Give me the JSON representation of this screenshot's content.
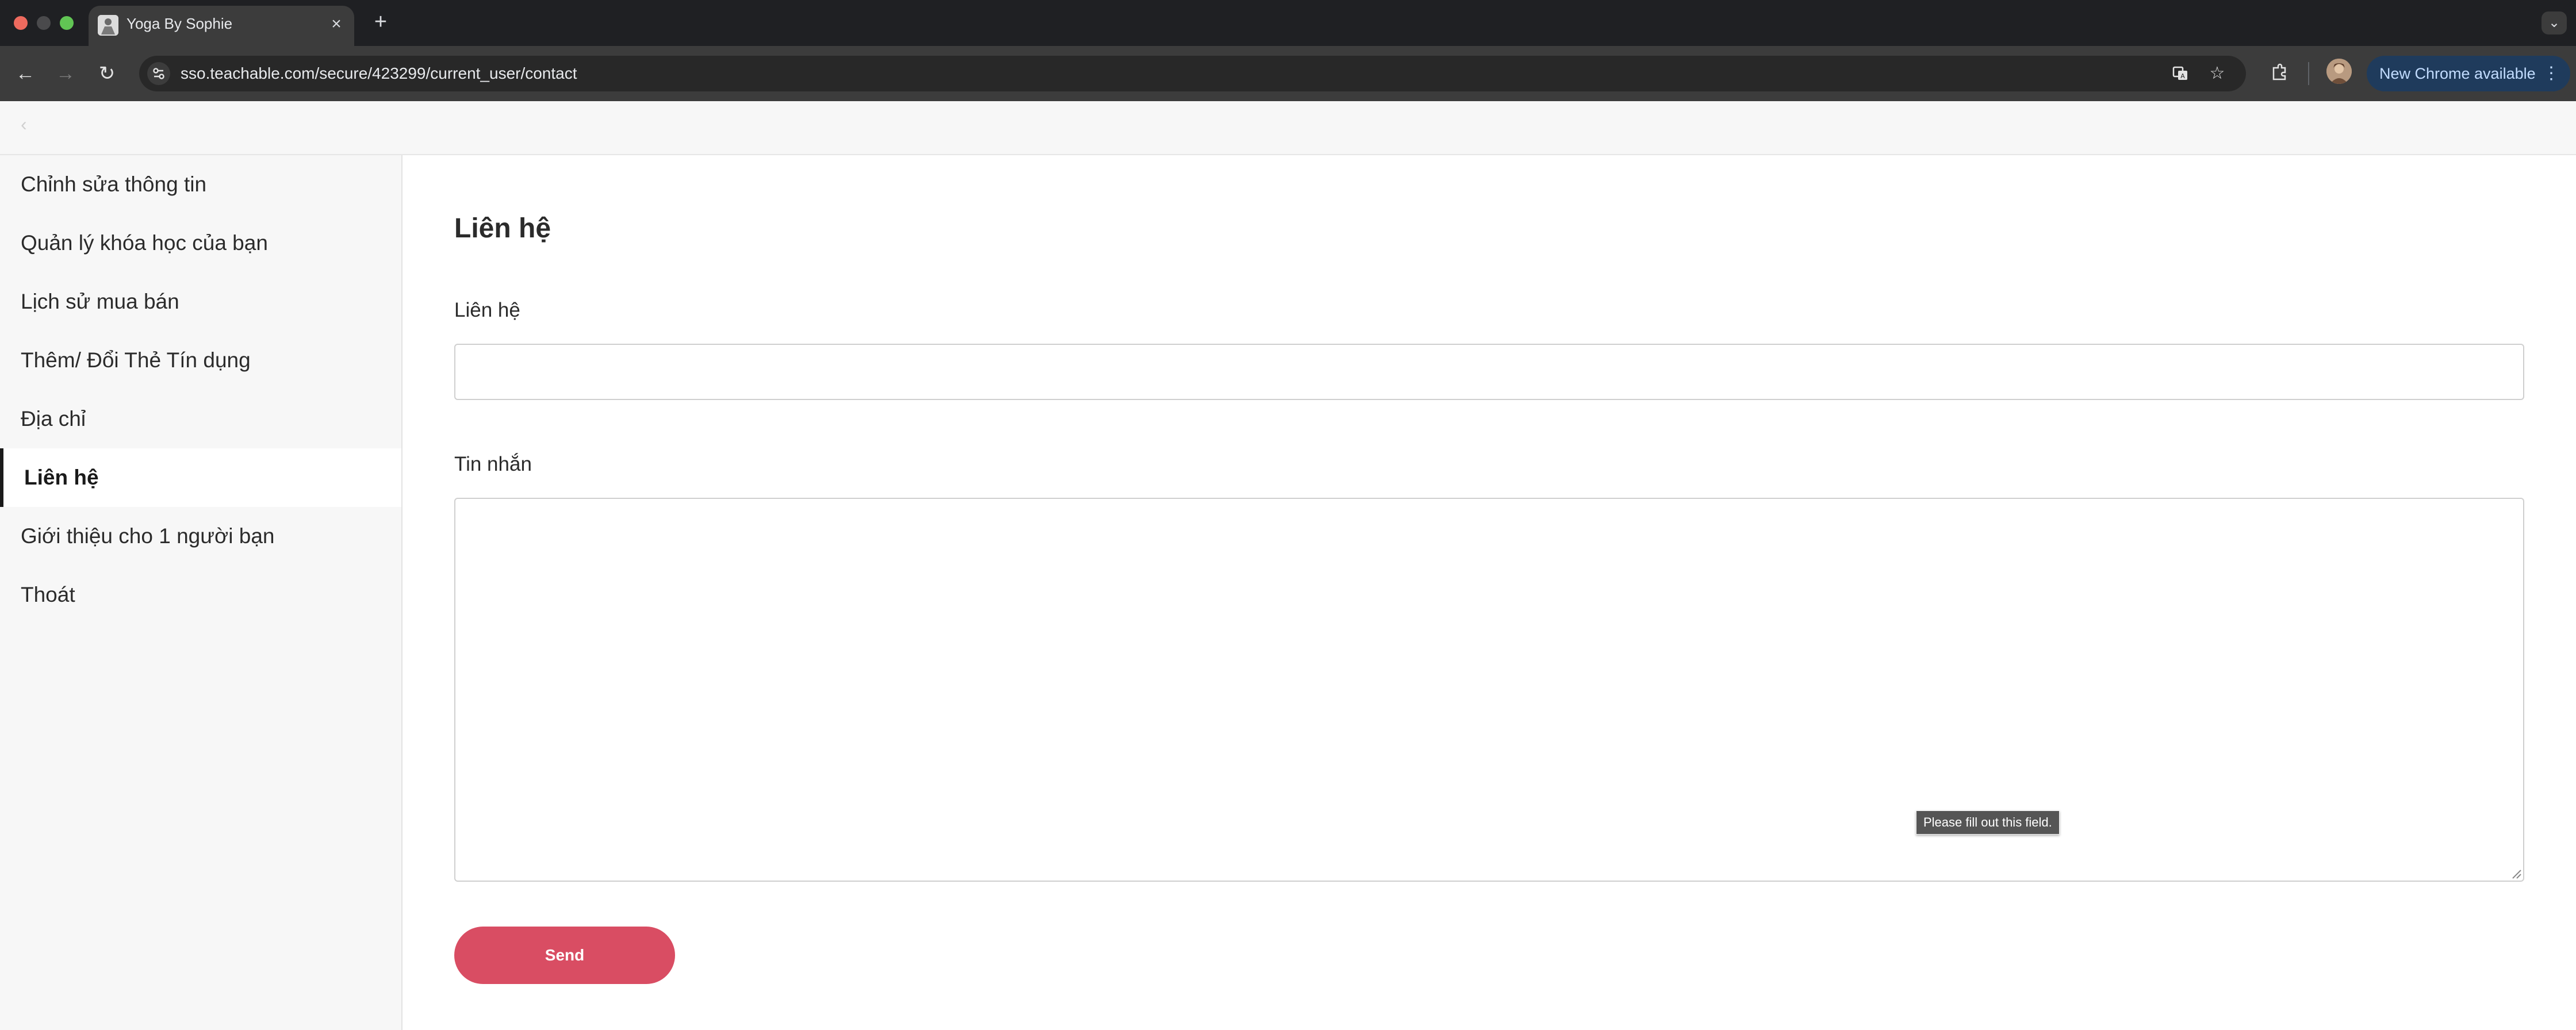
{
  "browser": {
    "tab": {
      "title": "Yoga By Sophie",
      "close": "×"
    },
    "new_tab": "+",
    "tab_search": "⌄",
    "nav": {
      "back": "←",
      "forward": "→",
      "reload": "↻"
    },
    "url": "sso.teachable.com/secure/423299/current_user/contact",
    "new_chrome_label": "New Chrome available",
    "menu_icon": "⋮"
  },
  "page_header": {
    "back": "‹"
  },
  "sidebar": {
    "items": [
      {
        "label": "Chỉnh sửa thông tin",
        "active": false
      },
      {
        "label": "Quản lý khóa học của bạn",
        "active": false
      },
      {
        "label": "Lịch sử mua bán",
        "active": false
      },
      {
        "label": "Thêm/ Đổi Thẻ Tín dụng",
        "active": false
      },
      {
        "label": "Địa chỉ",
        "active": false
      },
      {
        "label": "Liên hệ",
        "active": true
      },
      {
        "label": "Giới thiệu cho 1 người bạn",
        "active": false
      },
      {
        "label": "Thoát",
        "active": false
      }
    ]
  },
  "form": {
    "title": "Liên hệ",
    "contact_label": "Liên hệ",
    "contact_value": "",
    "message_label": "Tin nhắn",
    "message_value": "",
    "validation_tooltip": "Please fill out this field.",
    "send_label": "Send"
  },
  "colors": {
    "send_button": "#d94d63",
    "sidebar_bg": "#f7f7f7",
    "active_indicator": "#1a1a1a",
    "new_chrome_pill": "#1f3b5c"
  },
  "icons": [
    "apple-traffic-lights",
    "favicon-icon",
    "close-icon",
    "plus-icon",
    "chevron-down-icon",
    "back-arrow-icon",
    "forward-arrow-icon",
    "reload-icon",
    "site-settings-icon",
    "translate-icon",
    "star-icon",
    "extensions-icon",
    "profile-avatar",
    "more-vert-icon",
    "chevron-left-icon",
    "resize-grip-icon"
  ]
}
